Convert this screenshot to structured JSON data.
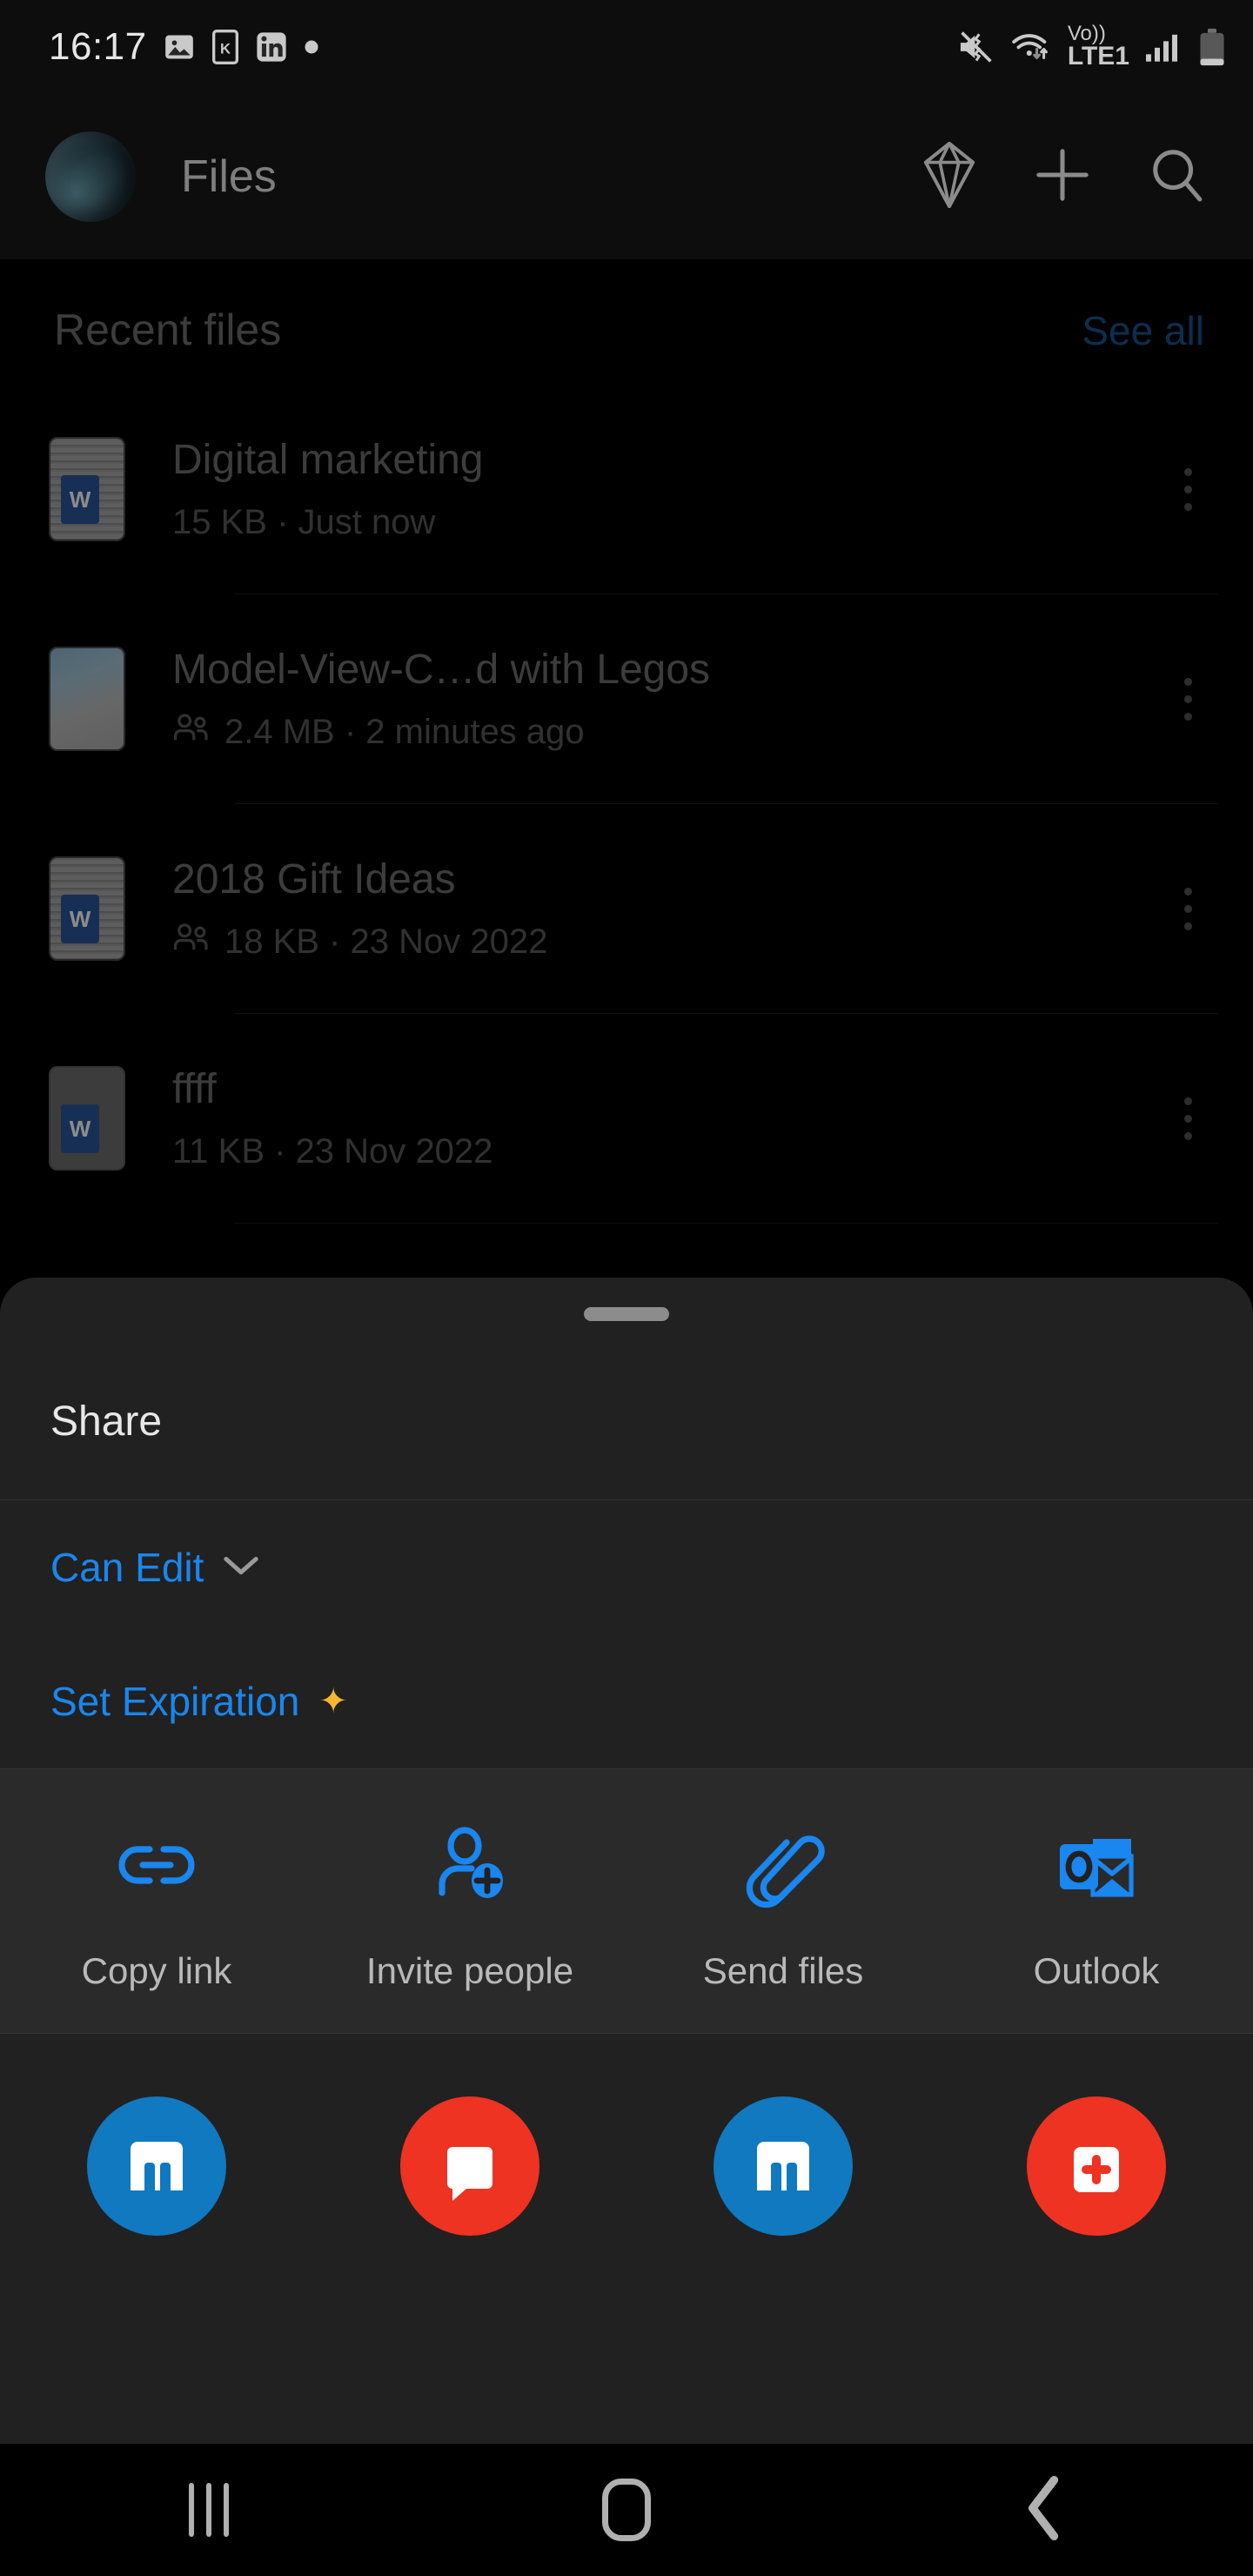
{
  "status_bar": {
    "time": "16:17",
    "left_icons": [
      "image-icon",
      "k-app-icon",
      "linkedin-icon",
      "dot-icon"
    ],
    "network_label": "Vo))",
    "network_sub": "LTE1",
    "right_icons": [
      "mute-vibrate-icon",
      "wifi-icon",
      "volte-icon",
      "signal-bars-icon",
      "battery-icon"
    ]
  },
  "app_bar": {
    "title": "Files",
    "avatar_name": "user-avatar",
    "actions": [
      {
        "name": "diamond-icon"
      },
      {
        "name": "add-icon"
      },
      {
        "name": "search-icon"
      }
    ]
  },
  "recent": {
    "title": "Recent files",
    "see_all": "See all",
    "files": [
      {
        "name": "Digital marketing",
        "meta": "15 KB · Just now",
        "shared": false,
        "thumb": "doc"
      },
      {
        "name": "Model-View-C…d with Legos",
        "meta": "2.4 MB · 2 minutes ago",
        "shared": true,
        "thumb": "mvc"
      },
      {
        "name": "2018 Gift Ideas",
        "meta": "18 KB · 23 Nov 2022",
        "shared": true,
        "thumb": "doc"
      },
      {
        "name": "ffff",
        "meta": "11 KB · 23 Nov 2022",
        "shared": false,
        "thumb": "blank"
      }
    ]
  },
  "share_sheet": {
    "title": "Share",
    "permission_label": "Can Edit",
    "expiration_label": "Set Expiration",
    "premium_star": "✦",
    "actions": [
      {
        "label": "Copy link",
        "icon": "link-icon"
      },
      {
        "label": "Invite people",
        "icon": "person-add-icon"
      },
      {
        "label": "Send files",
        "icon": "paperclip-icon"
      },
      {
        "label": "Outlook",
        "icon": "outlook-icon"
      }
    ],
    "apps": [
      {
        "name": "app-icon-blue-1",
        "color": "#1079bf"
      },
      {
        "name": "app-icon-red-1",
        "color": "#ee3322"
      },
      {
        "name": "app-icon-blue-2",
        "color": "#1079bf"
      },
      {
        "name": "app-icon-red-2",
        "color": "#ee3322"
      }
    ]
  },
  "nav_bar": {
    "recents": "recents-button",
    "home": "home-button",
    "back": "back-button"
  },
  "colors": {
    "accent_blue": "#1a86ef",
    "link_blue": "#17548f",
    "premium_gold": "#f5b731",
    "sheet_bg": "#212121",
    "panel_bg": "#2a2a2a"
  }
}
